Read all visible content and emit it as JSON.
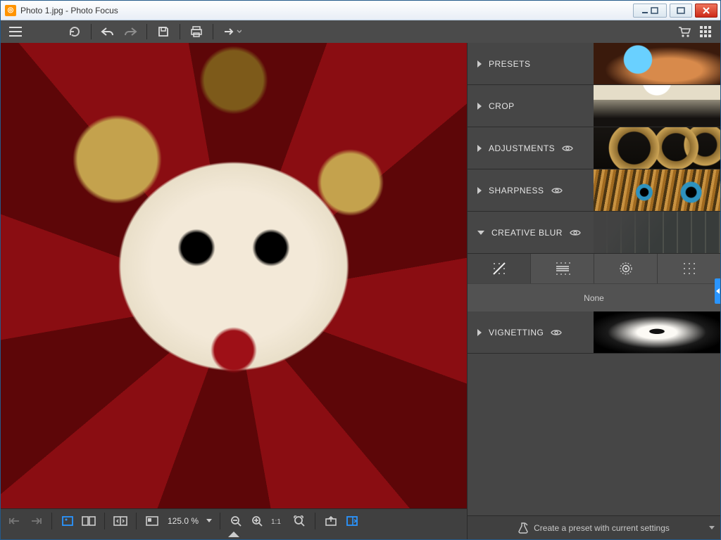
{
  "window": {
    "title": "Photo 1.jpg - Photo Focus"
  },
  "toolbar": {
    "icons": {
      "menu": "menu",
      "reset": "reset",
      "undo": "undo",
      "redo": "redo",
      "save": "save",
      "print": "print",
      "export": "export",
      "cart": "cart",
      "grid": "grid"
    }
  },
  "zoom": {
    "value": "125.0 %"
  },
  "panels": [
    {
      "id": "presets",
      "label": "PRESETS",
      "hasEye": false
    },
    {
      "id": "crop",
      "label": "CROP",
      "hasEye": false
    },
    {
      "id": "adjustments",
      "label": "ADJUSTMENTS",
      "hasEye": true
    },
    {
      "id": "sharpness",
      "label": "SHARPNESS",
      "hasEye": true
    },
    {
      "id": "creative",
      "label": "CREATIVE BLUR",
      "hasEye": true
    },
    {
      "id": "vignetting",
      "label": "VIGNETTING",
      "hasEye": true
    }
  ],
  "creative_blur": {
    "tools": [
      "none",
      "linear",
      "radial",
      "dot-grid"
    ],
    "active_tool": "none",
    "status": "None"
  },
  "preset_action": {
    "label": "Create a preset with current settings"
  }
}
